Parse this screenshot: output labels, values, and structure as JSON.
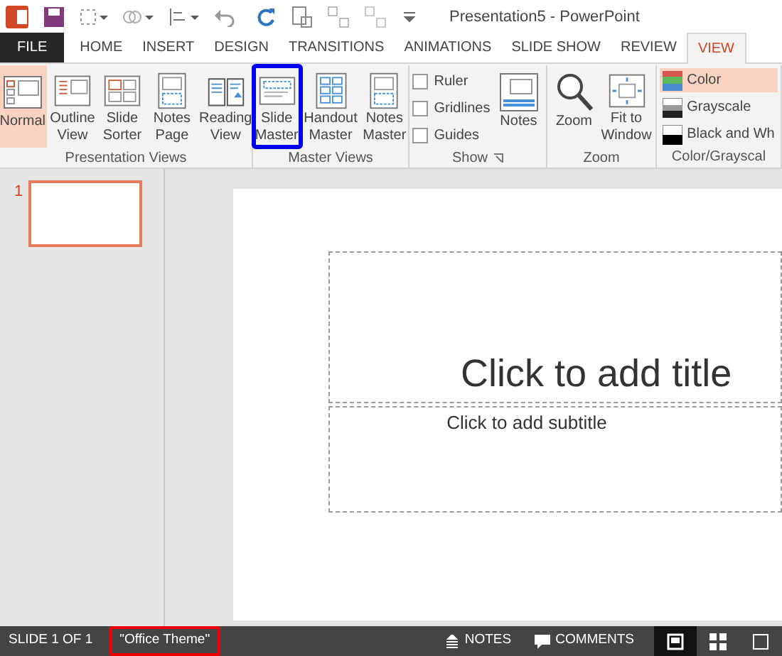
{
  "window": {
    "title": "Presentation5 - PowerPoint"
  },
  "tabs": [
    {
      "label": "FILE",
      "kind": "file",
      "selected": false
    },
    {
      "label": "HOME",
      "kind": "tab",
      "selected": false
    },
    {
      "label": "INSERT",
      "kind": "tab",
      "selected": false
    },
    {
      "label": "DESIGN",
      "kind": "tab",
      "selected": false
    },
    {
      "label": "TRANSITIONS",
      "kind": "tab",
      "selected": false
    },
    {
      "label": "ANIMATIONS",
      "kind": "tab",
      "selected": false
    },
    {
      "label": "SLIDE SHOW",
      "kind": "tab",
      "selected": false
    },
    {
      "label": "REVIEW",
      "kind": "tab",
      "selected": false
    },
    {
      "label": "VIEW",
      "kind": "tab",
      "selected": true
    }
  ],
  "ribbon": {
    "groups": [
      {
        "label": "Presentation Views",
        "kind": "buttons",
        "items": [
          {
            "lines": [
              "Normal"
            ],
            "selected": true,
            "annotated": false
          },
          {
            "lines": [
              "Outline",
              "View"
            ],
            "selected": false,
            "annotated": false
          },
          {
            "lines": [
              "Slide",
              "Sorter"
            ],
            "selected": false,
            "annotated": false
          },
          {
            "lines": [
              "Notes",
              "Page"
            ],
            "selected": false,
            "annotated": false
          },
          {
            "lines": [
              "Reading",
              "View"
            ],
            "selected": false,
            "annotated": false
          }
        ]
      },
      {
        "label": "Master Views",
        "kind": "buttons",
        "items": [
          {
            "lines": [
              "Slide",
              "Master"
            ],
            "selected": false,
            "annotated": true
          },
          {
            "lines": [
              "Handout",
              "Master"
            ],
            "selected": false,
            "annotated": false
          },
          {
            "lines": [
              "Notes",
              "Master"
            ],
            "selected": false,
            "annotated": false
          }
        ]
      },
      {
        "label": "Show",
        "kind": "show",
        "checks": [
          {
            "label": "Ruler",
            "checked": false
          },
          {
            "label": "Gridlines",
            "checked": false
          },
          {
            "label": "Guides",
            "checked": false
          }
        ],
        "items": [
          {
            "lines": [
              "Notes"
            ],
            "selected": false,
            "annotated": false
          }
        ]
      },
      {
        "label": "Zoom",
        "kind": "buttons",
        "items": [
          {
            "lines": [
              "Zoom"
            ],
            "selected": false,
            "annotated": false
          },
          {
            "lines": [
              "Fit to",
              "Window"
            ],
            "selected": false,
            "annotated": false
          }
        ]
      },
      {
        "label": "Color/Grayscal",
        "kind": "colors",
        "options": [
          {
            "label": "Color",
            "selected": true
          },
          {
            "label": "Grayscale",
            "selected": false
          },
          {
            "label": "Black and Wh",
            "selected": false
          }
        ]
      }
    ]
  },
  "thumbnails": [
    {
      "number": "1",
      "selected": true
    }
  ],
  "slide": {
    "title_placeholder": "Click to add title",
    "subtitle_placeholder": "Click to add subtitle"
  },
  "status_bar": {
    "slide_count": "SLIDE 1 OF 1",
    "theme": {
      "label": "\"Office Theme\"",
      "annotated": true
    },
    "notes": "NOTES",
    "comments": "COMMENTS",
    "views": [
      {
        "selected": true
      },
      {
        "selected": false
      },
      {
        "selected": false
      }
    ]
  }
}
